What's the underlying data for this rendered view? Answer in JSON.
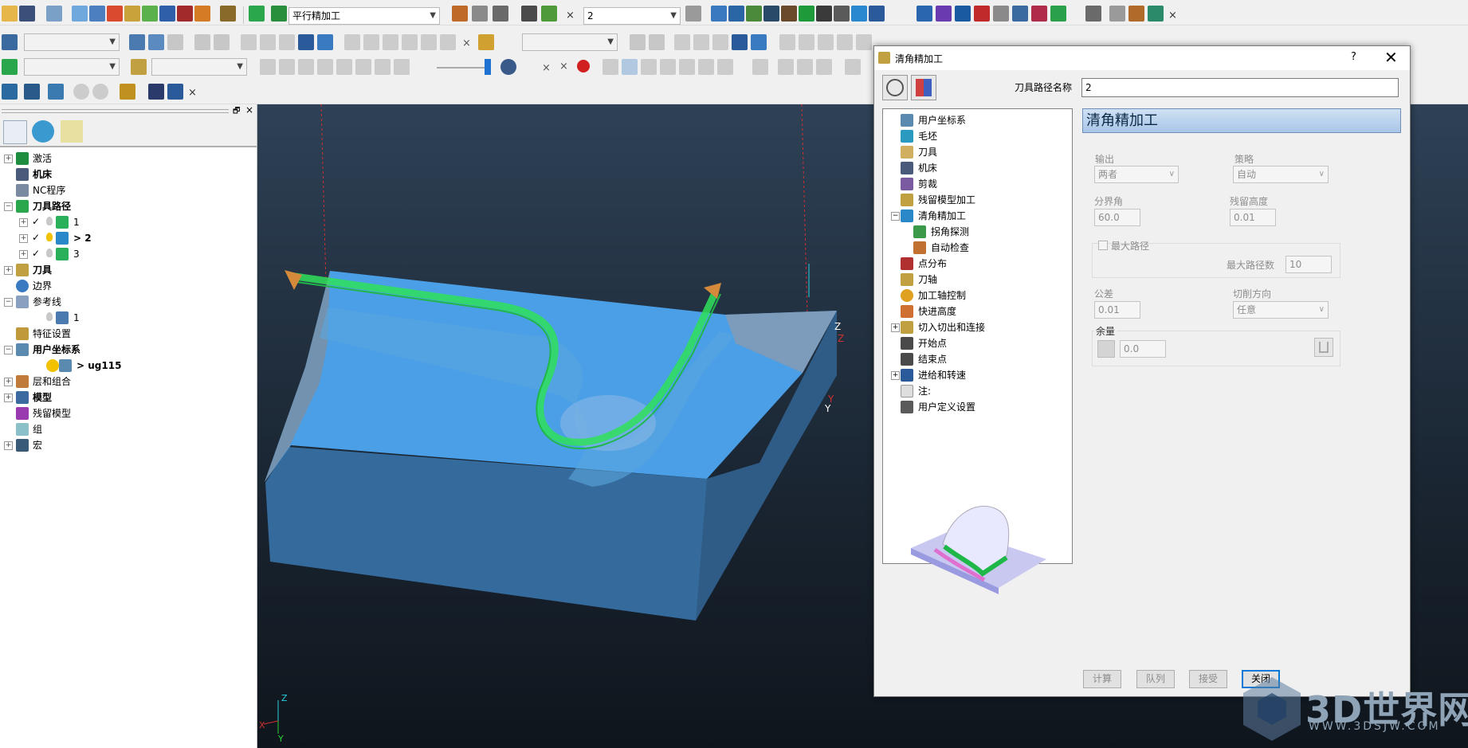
{
  "toolbar": {
    "strategy_combo": "平行精加工",
    "toolpath_combo": "2",
    "close_glyph": "×"
  },
  "tree": {
    "items": [
      {
        "label": "激活"
      },
      {
        "label": "机床"
      },
      {
        "label": "NC程序"
      },
      {
        "label": "刀具路径"
      },
      {
        "label": "1"
      },
      {
        "label": "> 2"
      },
      {
        "label": "3"
      },
      {
        "label": "刀具"
      },
      {
        "label": "边界"
      },
      {
        "label": "参考线"
      },
      {
        "label": "1"
      },
      {
        "label": "特征设置"
      },
      {
        "label": "用户坐标系"
      },
      {
        "label": "> ug115"
      },
      {
        "label": "层和组合"
      },
      {
        "label": "模型"
      },
      {
        "label": "残留模型"
      },
      {
        "label": "组"
      },
      {
        "label": "宏"
      }
    ]
  },
  "viewport": {
    "axis_small": {
      "x": "X",
      "y": "Y",
      "z": "Z"
    },
    "axis_model": {
      "z_label": "Z",
      "z_red": "Z",
      "y_red": "Y",
      "y_label": "Y"
    }
  },
  "dialog": {
    "title": "清角精加工",
    "help": "?",
    "close": "✕",
    "name_label": "刀具路径名称",
    "name_value": "2",
    "tree": [
      {
        "label": "用户坐标系"
      },
      {
        "label": "毛坯"
      },
      {
        "label": "刀具"
      },
      {
        "label": "机床"
      },
      {
        "label": "剪裁"
      },
      {
        "label": "残留模型加工"
      },
      {
        "label": "清角精加工"
      },
      {
        "label": "拐角探测"
      },
      {
        "label": "自动检查"
      },
      {
        "label": "点分布"
      },
      {
        "label": "刀轴"
      },
      {
        "label": "加工轴控制"
      },
      {
        "label": "快进高度"
      },
      {
        "label": "切入切出和连接"
      },
      {
        "label": "开始点"
      },
      {
        "label": "结束点"
      },
      {
        "label": "进给和转速"
      },
      {
        "label": "注:"
      },
      {
        "label": "用户定义设置"
      }
    ],
    "page_title": "清角精加工",
    "output_label": "输出",
    "output_value": "两者",
    "strategy_label": "策略",
    "strategy_value": "自动",
    "threshold_label": "分界角",
    "threshold_value": "60.0",
    "cusp_label": "残留高度",
    "cusp_value": "0.01",
    "maxpath_label": "最大路径",
    "maxpath_count_label": "最大路径数",
    "maxpath_count_value": "10",
    "tolerance_label": "公差",
    "tolerance_value": "0.01",
    "cut_dir_label": "切削方向",
    "cut_dir_value": "任意",
    "allowance_label": "余量",
    "allowance_value": "0.0",
    "buttons": {
      "calculate": "计算",
      "queue": "队列",
      "accept": "接受",
      "close": "关闭"
    }
  },
  "watermark": {
    "big": "3D世界网",
    "small": "WWW.3DSJW.COM"
  },
  "colors": {
    "accent": "#0078d7",
    "model_top": "#4aa3e6",
    "toolpath": "#2fe05a",
    "viewport_top": "#2e4156",
    "viewport_bottom": "#0f151c"
  }
}
